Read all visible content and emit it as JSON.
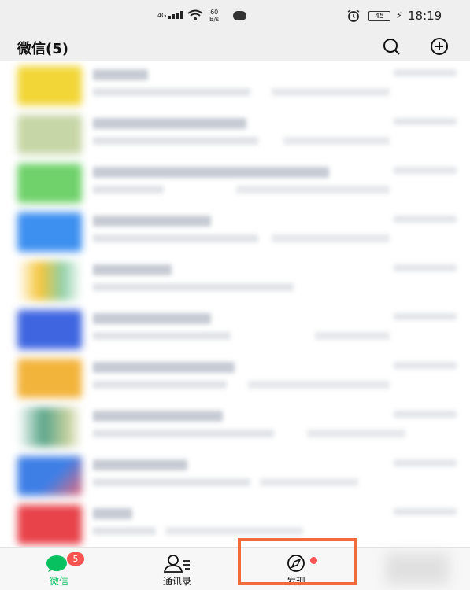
{
  "status_bar": {
    "network": "4G",
    "speed_value": "60",
    "speed_unit": "B/s",
    "battery": "45",
    "time": "18:19"
  },
  "header": {
    "title": "微信(5)",
    "search_icon": "search-icon",
    "add_icon": "plus-circle-icon"
  },
  "chats": [
    {
      "avatar_color": "#f2d637"
    },
    {
      "avatar_color": "#c7d6a6"
    },
    {
      "avatar_color": "#6fd26a"
    },
    {
      "avatar_color": "#3d8ff0"
    },
    {
      "avatar_color": "#f5c53a"
    },
    {
      "avatar_color": "#3f66e0"
    },
    {
      "avatar_color": "#f3b43c"
    },
    {
      "avatar_color": "#5aa58a"
    },
    {
      "avatar_color": "#3e7fe6"
    },
    {
      "avatar_color": "#e8434a"
    }
  ],
  "tabbar": {
    "tabs": [
      {
        "label": "微信",
        "icon": "chat-icon",
        "badge": "5",
        "active": true
      },
      {
        "label": "通讯录",
        "icon": "contacts-icon"
      },
      {
        "label": "发现",
        "icon": "compass-icon"
      }
    ]
  },
  "colors": {
    "accent": "#07c160",
    "badge": "#fa5151",
    "highlight": "#f26b3a"
  }
}
